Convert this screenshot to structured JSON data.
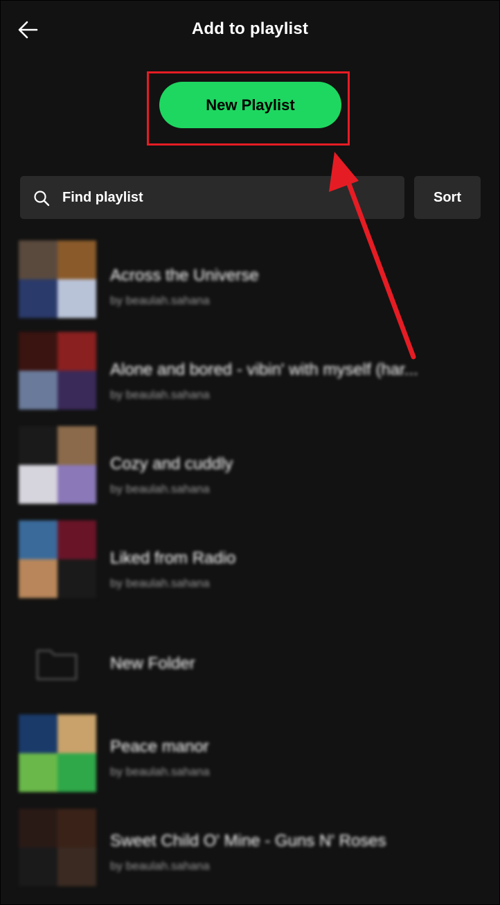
{
  "header": {
    "title": "Add to playlist",
    "back_icon": "back-arrow-icon"
  },
  "new_playlist": {
    "label": "New Playlist"
  },
  "search": {
    "placeholder": "Find playlist",
    "icon": "search-icon"
  },
  "sort": {
    "label": "Sort"
  },
  "colors": {
    "background": "#121212",
    "accent": "#1ed760",
    "annotation": "#e61c24",
    "field": "#2a2a2a",
    "subtext": "#9a9a9a"
  },
  "playlists": [
    {
      "title": "Across the Universe",
      "subtitle": "by beaulah.sahana",
      "art_colors": [
        "#5a4a3e",
        "#8a5a2a",
        "#2a3a6a",
        "#b9c3d8"
      ]
    },
    {
      "title": "Alone and bored - vibin' with myself (har...",
      "subtitle": "by beaulah.sahana",
      "art_colors": [
        "#3a1410",
        "#8a2020",
        "#6a7a9a",
        "#3a2a5a"
      ]
    },
    {
      "title": "Cozy and cuddly",
      "subtitle": "by beaulah.sahana",
      "art_colors": [
        "#1a1a1a",
        "#8a6a4a",
        "#d6d4dc",
        "#8a78b8"
      ]
    },
    {
      "title": "Liked from Radio",
      "subtitle": "by beaulah.sahana",
      "art_colors": [
        "#3a6a9a",
        "#6a1428",
        "#b8865a",
        "#1a1a1a"
      ]
    },
    {
      "title": "New Folder",
      "subtitle": "",
      "art_colors": []
    },
    {
      "title": "Peace manor",
      "subtitle": "by beaulah.sahana",
      "art_colors": [
        "#1a3a6a",
        "#c8a26a",
        "#6ab84a",
        "#2fa84a"
      ]
    },
    {
      "title": "Sweet Child O' Mine - Guns N' Roses",
      "subtitle": "by beaulah.sahana",
      "art_colors": [
        "#2a1a16",
        "#3a2218",
        "#1a1a1a",
        "#3a2a22"
      ]
    }
  ]
}
